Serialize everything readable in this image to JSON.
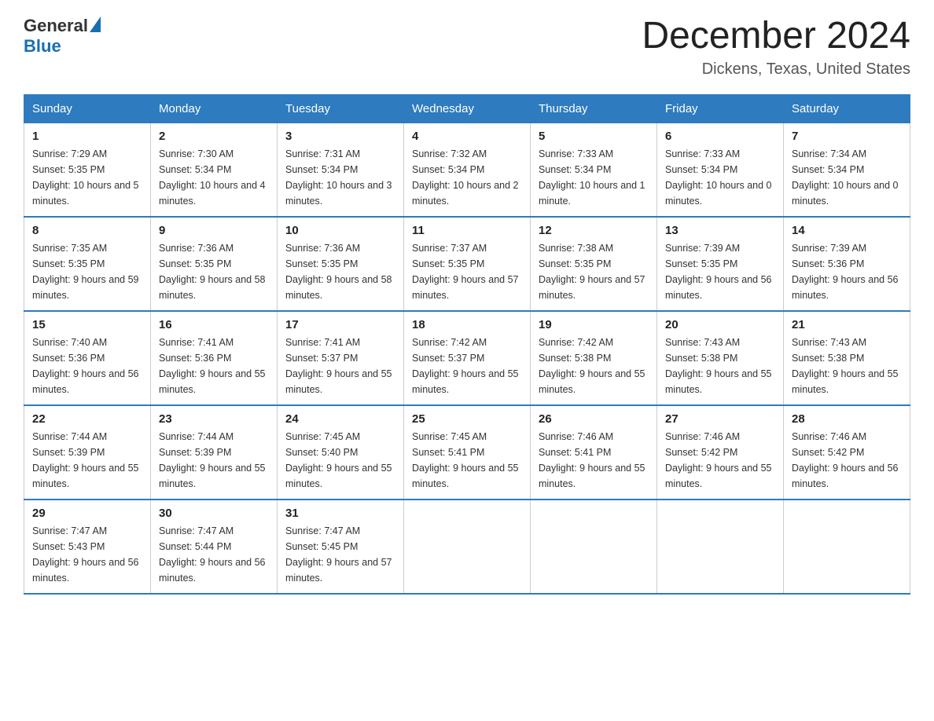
{
  "header": {
    "logo": {
      "general": "General",
      "blue": "Blue",
      "aria": "General Blue Logo"
    },
    "title": "December 2024",
    "location": "Dickens, Texas, United States"
  },
  "calendar": {
    "days_of_week": [
      "Sunday",
      "Monday",
      "Tuesday",
      "Wednesday",
      "Thursday",
      "Friday",
      "Saturday"
    ],
    "weeks": [
      [
        {
          "day": "1",
          "sunrise": "7:29 AM",
          "sunset": "5:35 PM",
          "daylight": "10 hours and 5 minutes."
        },
        {
          "day": "2",
          "sunrise": "7:30 AM",
          "sunset": "5:34 PM",
          "daylight": "10 hours and 4 minutes."
        },
        {
          "day": "3",
          "sunrise": "7:31 AM",
          "sunset": "5:34 PM",
          "daylight": "10 hours and 3 minutes."
        },
        {
          "day": "4",
          "sunrise": "7:32 AM",
          "sunset": "5:34 PM",
          "daylight": "10 hours and 2 minutes."
        },
        {
          "day": "5",
          "sunrise": "7:33 AM",
          "sunset": "5:34 PM",
          "daylight": "10 hours and 1 minute."
        },
        {
          "day": "6",
          "sunrise": "7:33 AM",
          "sunset": "5:34 PM",
          "daylight": "10 hours and 0 minutes."
        },
        {
          "day": "7",
          "sunrise": "7:34 AM",
          "sunset": "5:34 PM",
          "daylight": "10 hours and 0 minutes."
        }
      ],
      [
        {
          "day": "8",
          "sunrise": "7:35 AM",
          "sunset": "5:35 PM",
          "daylight": "9 hours and 59 minutes."
        },
        {
          "day": "9",
          "sunrise": "7:36 AM",
          "sunset": "5:35 PM",
          "daylight": "9 hours and 58 minutes."
        },
        {
          "day": "10",
          "sunrise": "7:36 AM",
          "sunset": "5:35 PM",
          "daylight": "9 hours and 58 minutes."
        },
        {
          "day": "11",
          "sunrise": "7:37 AM",
          "sunset": "5:35 PM",
          "daylight": "9 hours and 57 minutes."
        },
        {
          "day": "12",
          "sunrise": "7:38 AM",
          "sunset": "5:35 PM",
          "daylight": "9 hours and 57 minutes."
        },
        {
          "day": "13",
          "sunrise": "7:39 AM",
          "sunset": "5:35 PM",
          "daylight": "9 hours and 56 minutes."
        },
        {
          "day": "14",
          "sunrise": "7:39 AM",
          "sunset": "5:36 PM",
          "daylight": "9 hours and 56 minutes."
        }
      ],
      [
        {
          "day": "15",
          "sunrise": "7:40 AM",
          "sunset": "5:36 PM",
          "daylight": "9 hours and 56 minutes."
        },
        {
          "day": "16",
          "sunrise": "7:41 AM",
          "sunset": "5:36 PM",
          "daylight": "9 hours and 55 minutes."
        },
        {
          "day": "17",
          "sunrise": "7:41 AM",
          "sunset": "5:37 PM",
          "daylight": "9 hours and 55 minutes."
        },
        {
          "day": "18",
          "sunrise": "7:42 AM",
          "sunset": "5:37 PM",
          "daylight": "9 hours and 55 minutes."
        },
        {
          "day": "19",
          "sunrise": "7:42 AM",
          "sunset": "5:38 PM",
          "daylight": "9 hours and 55 minutes."
        },
        {
          "day": "20",
          "sunrise": "7:43 AM",
          "sunset": "5:38 PM",
          "daylight": "9 hours and 55 minutes."
        },
        {
          "day": "21",
          "sunrise": "7:43 AM",
          "sunset": "5:38 PM",
          "daylight": "9 hours and 55 minutes."
        }
      ],
      [
        {
          "day": "22",
          "sunrise": "7:44 AM",
          "sunset": "5:39 PM",
          "daylight": "9 hours and 55 minutes."
        },
        {
          "day": "23",
          "sunrise": "7:44 AM",
          "sunset": "5:39 PM",
          "daylight": "9 hours and 55 minutes."
        },
        {
          "day": "24",
          "sunrise": "7:45 AM",
          "sunset": "5:40 PM",
          "daylight": "9 hours and 55 minutes."
        },
        {
          "day": "25",
          "sunrise": "7:45 AM",
          "sunset": "5:41 PM",
          "daylight": "9 hours and 55 minutes."
        },
        {
          "day": "26",
          "sunrise": "7:46 AM",
          "sunset": "5:41 PM",
          "daylight": "9 hours and 55 minutes."
        },
        {
          "day": "27",
          "sunrise": "7:46 AM",
          "sunset": "5:42 PM",
          "daylight": "9 hours and 55 minutes."
        },
        {
          "day": "28",
          "sunrise": "7:46 AM",
          "sunset": "5:42 PM",
          "daylight": "9 hours and 56 minutes."
        }
      ],
      [
        {
          "day": "29",
          "sunrise": "7:47 AM",
          "sunset": "5:43 PM",
          "daylight": "9 hours and 56 minutes."
        },
        {
          "day": "30",
          "sunrise": "7:47 AM",
          "sunset": "5:44 PM",
          "daylight": "9 hours and 56 minutes."
        },
        {
          "day": "31",
          "sunrise": "7:47 AM",
          "sunset": "5:45 PM",
          "daylight": "9 hours and 57 minutes."
        },
        null,
        null,
        null,
        null
      ]
    ],
    "labels": {
      "sunrise": "Sunrise:",
      "sunset": "Sunset:",
      "daylight": "Daylight:"
    }
  }
}
